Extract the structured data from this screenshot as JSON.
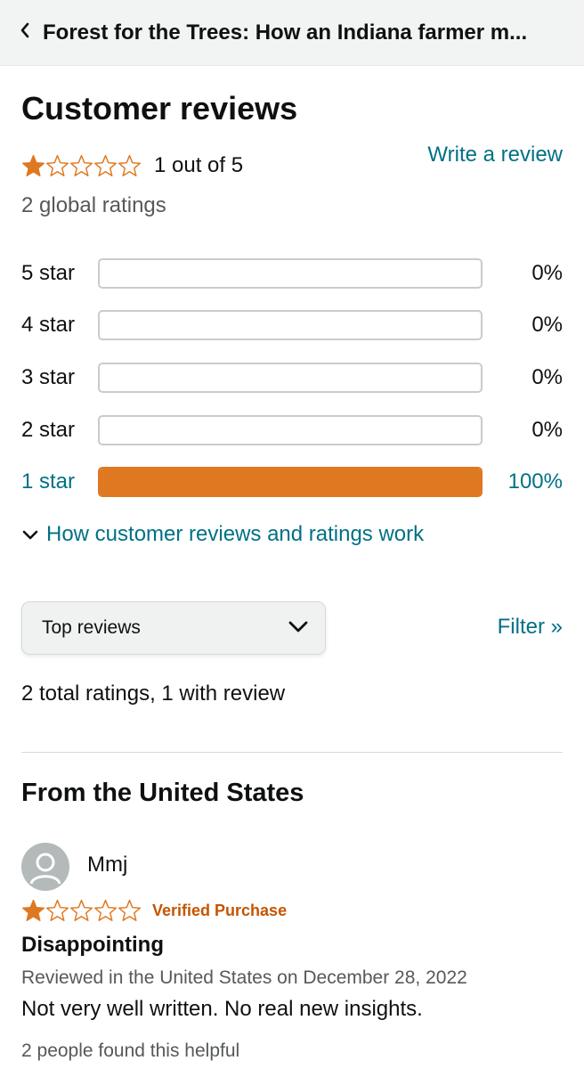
{
  "header": {
    "title": "Forest for the Trees: How an Indiana farmer m..."
  },
  "reviews_summary": {
    "heading": "Customer reviews",
    "average_rating": 1,
    "max_rating": 5,
    "rating_text": "1 out of 5",
    "write_review_label": "Write a review",
    "global_ratings": "2 global ratings"
  },
  "histogram": [
    {
      "label": "5 star",
      "percent_text": "0%",
      "fraction": 0
    },
    {
      "label": "4 star",
      "percent_text": "0%",
      "fraction": 0
    },
    {
      "label": "3 star",
      "percent_text": "0%",
      "fraction": 0
    },
    {
      "label": "2 star",
      "percent_text": "0%",
      "fraction": 0
    },
    {
      "label": "1 star",
      "percent_text": "100%",
      "fraction": 1
    }
  ],
  "how_reviews_work_label": "How customer reviews and ratings work",
  "sort": {
    "selected": "Top reviews"
  },
  "filter_label": "Filter »",
  "total_ratings_text": "2 total ratings, 1 with review",
  "region_heading": "From the United States",
  "review": {
    "author": "Mmj",
    "rating": 1,
    "verified_label": "Verified Purchase",
    "title": "Disappointing",
    "date_line": "Reviewed in the United States on December 28, 2022",
    "body": "Not very well written. No real new insights.",
    "helpful_text": "2 people found this helpful"
  },
  "colors": {
    "link": "#007185",
    "star": "#de7921",
    "verified": "#c45500",
    "muted_text": "#565959",
    "header_bg": "#f2f3f3"
  }
}
